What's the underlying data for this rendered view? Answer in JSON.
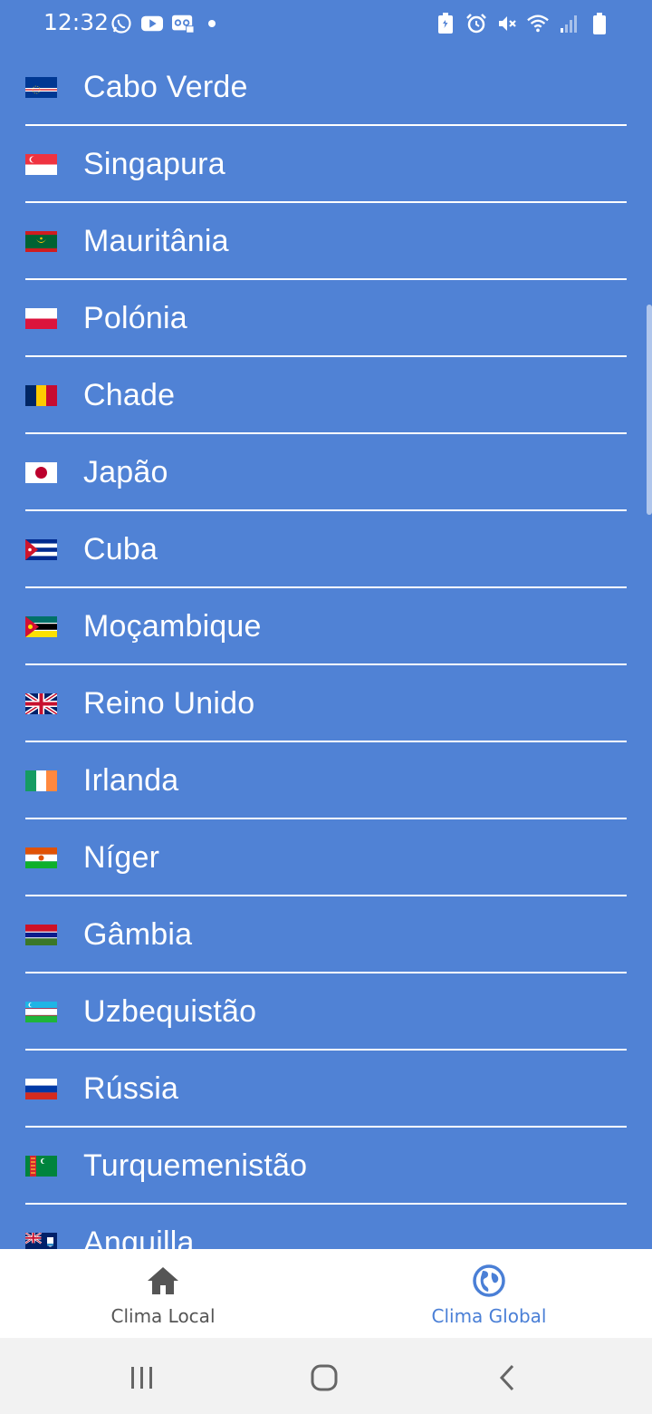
{
  "status_bar": {
    "time": "12:32",
    "left_icons": [
      "whatsapp-icon",
      "youtube-icon",
      "voicemail-icon"
    ],
    "right_icons": [
      "battery-saver-icon",
      "alarm-icon",
      "mute-icon",
      "wifi-icon",
      "signal-icon",
      "battery-icon"
    ]
  },
  "countries": [
    {
      "name": "Cabo Verde",
      "flag": "cape-verde"
    },
    {
      "name": "Singapura",
      "flag": "singapore"
    },
    {
      "name": "Mauritânia",
      "flag": "mauritania"
    },
    {
      "name": "Polónia",
      "flag": "poland"
    },
    {
      "name": "Chade",
      "flag": "chad"
    },
    {
      "name": "Japão",
      "flag": "japan"
    },
    {
      "name": "Cuba",
      "flag": "cuba"
    },
    {
      "name": "Moçambique",
      "flag": "mozambique"
    },
    {
      "name": "Reino Unido",
      "flag": "united-kingdom"
    },
    {
      "name": "Irlanda",
      "flag": "ireland"
    },
    {
      "name": "Níger",
      "flag": "niger"
    },
    {
      "name": "Gâmbia",
      "flag": "gambia"
    },
    {
      "name": "Uzbequistão",
      "flag": "uzbekistan"
    },
    {
      "name": "Rússia",
      "flag": "russia"
    },
    {
      "name": "Turquemenistão",
      "flag": "turkmenistan"
    },
    {
      "name": "Anguilla",
      "flag": "anguilla"
    }
  ],
  "bottom_nav": {
    "tabs": [
      {
        "label": "Clima Local",
        "icon": "home-icon",
        "active": false
      },
      {
        "label": "Clima Global",
        "icon": "globe-icon",
        "active": true
      }
    ]
  },
  "colors": {
    "background": "#5082d5",
    "accent": "#4a7fd6",
    "nav_inactive": "#555555"
  }
}
